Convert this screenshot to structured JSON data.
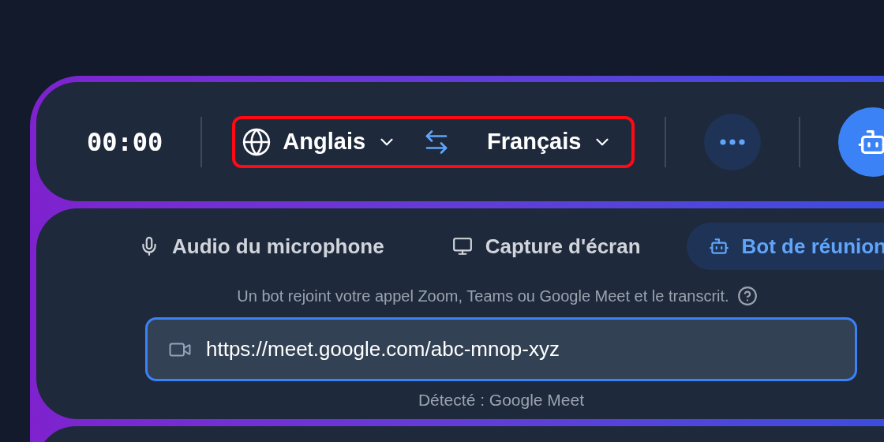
{
  "timer": "00:00",
  "language_selector": {
    "highlighted": true,
    "source": "Anglais",
    "target": "Français"
  },
  "mode_tabs": [
    {
      "kind": "mic",
      "label": "Audio du microphone",
      "selected": false
    },
    {
      "kind": "screen",
      "label": "Capture d'écran",
      "selected": false
    },
    {
      "kind": "bot",
      "label": "Bot de réunion",
      "selected": true
    }
  ],
  "help_text": "Un bot rejoint votre appel Zoom, Teams ou Google Meet et le transcrit.",
  "meeting_url_field": {
    "value": "https://meet.google.com/abc-mnop-xyz"
  },
  "detected_text": "Détecté : Google Meet"
}
